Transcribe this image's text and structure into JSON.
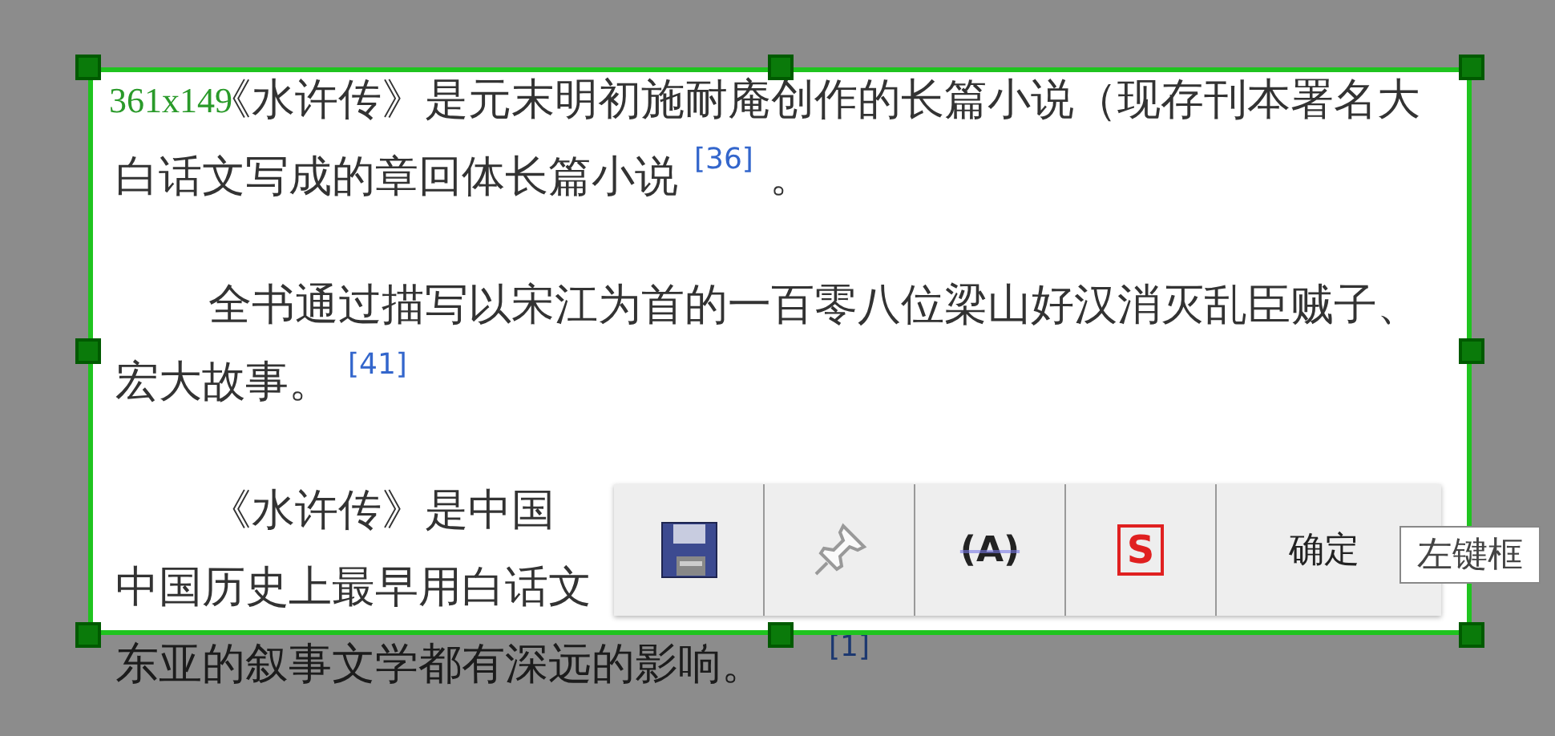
{
  "article": {
    "paragraphs": [
      {
        "lines": [
          [
            {
              "kind": "text",
              "text": "《水许传》是元末明初施耐庵创作的长篇小说（现存刊本署名大"
            }
          ],
          [
            {
              "kind": "text",
              "text": "白话文写成的章回体长篇小说"
            },
            {
              "kind": "citation",
              "text": "[36]"
            },
            {
              "kind": "text",
              "text": "。"
            }
          ]
        ]
      },
      {
        "lines": [
          [
            {
              "kind": "text",
              "text": "全书通过描写以宋江为首的一百零八位梁山好汉消灭乱臣贼子、"
            }
          ],
          [
            {
              "kind": "text",
              "text": "宏大故事。"
            },
            {
              "kind": "citation",
              "text": "[41]"
            }
          ]
        ]
      },
      {
        "lines": [
          [
            {
              "kind": "text",
              "text": "《水许传》是中国"
            }
          ],
          [
            {
              "kind": "text",
              "text": "中国历史上最早用白话文"
            }
          ],
          [
            {
              "kind": "text",
              "text": "东亚的叙事文学都有深远的影响。"
            },
            {
              "kind": "citation",
              "text": "[1]"
            }
          ]
        ]
      }
    ]
  },
  "selection": {
    "size_label": "361x149"
  },
  "toolbar": {
    "buttons": [
      {
        "kind": "save"
      },
      {
        "kind": "pin"
      },
      {
        "kind": "text",
        "label": "(A)"
      },
      {
        "kind": "stamp",
        "label": "S"
      },
      {
        "kind": "confirm",
        "label": "确定"
      }
    ]
  },
  "tooltip": "左键框"
}
